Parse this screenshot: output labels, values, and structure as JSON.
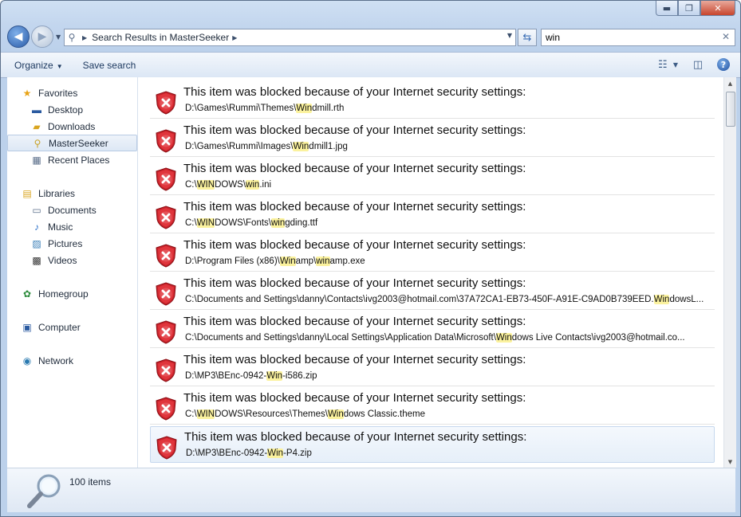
{
  "window": {
    "buttons": {
      "minimize": "▬",
      "maximize": "❐",
      "close": "✕"
    }
  },
  "address": {
    "crumb": "Search Results in MasterSeeker"
  },
  "search": {
    "value": "win"
  },
  "toolbar": {
    "organize": "Organize",
    "save_search": "Save search"
  },
  "sidebar": {
    "favorites": "Favorites",
    "desktop": "Desktop",
    "downloads": "Downloads",
    "masterseeker": "MasterSeeker",
    "recent_places": "Recent Places",
    "libraries": "Libraries",
    "documents": "Documents",
    "music": "Music",
    "pictures": "Pictures",
    "videos": "Videos",
    "homegroup": "Homegroup",
    "computer": "Computer",
    "network": "Network"
  },
  "results": {
    "message": "This item was blocked because of your Internet security settings:",
    "items": [
      {
        "path": [
          [
            "D:\\Games\\Rummi\\Themes\\",
            0
          ],
          [
            "Win",
            1
          ],
          [
            "dmill.rth",
            0
          ]
        ]
      },
      {
        "path": [
          [
            "D:\\Games\\Rummi\\Images\\",
            0
          ],
          [
            "Win",
            1
          ],
          [
            "dmill1.jpg",
            0
          ]
        ]
      },
      {
        "path": [
          [
            "C:\\",
            0
          ],
          [
            "WIN",
            1
          ],
          [
            "DOWS\\",
            0
          ],
          [
            "win",
            1
          ],
          [
            ".ini",
            0
          ]
        ]
      },
      {
        "path": [
          [
            "C:\\",
            0
          ],
          [
            "WIN",
            1
          ],
          [
            "DOWS\\Fonts\\",
            0
          ],
          [
            "win",
            1
          ],
          [
            "gding.ttf",
            0
          ]
        ]
      },
      {
        "path": [
          [
            "D:\\Program Files (x86)\\",
            0
          ],
          [
            "Win",
            1
          ],
          [
            "amp\\",
            0
          ],
          [
            "win",
            1
          ],
          [
            "amp.exe",
            0
          ]
        ]
      },
      {
        "path": [
          [
            "C:\\Documents and Settings\\danny\\Contacts\\ivg2003@hotmail.com\\37A72CA1-EB73-450F-A91E-C9AD0B739EED.",
            0
          ],
          [
            "Win",
            1
          ],
          [
            "dowsL...",
            0
          ]
        ]
      },
      {
        "path": [
          [
            "C:\\Documents and Settings\\danny\\Local Settings\\Application Data\\Microsoft\\",
            0
          ],
          [
            "Win",
            1
          ],
          [
            "dows Live Contacts\\ivg2003@hotmail.co...",
            0
          ]
        ]
      },
      {
        "path": [
          [
            "D:\\MP3\\BEnc-0942-",
            0
          ],
          [
            "Win",
            1
          ],
          [
            "-i586.zip",
            0
          ]
        ]
      },
      {
        "path": [
          [
            "C:\\",
            0
          ],
          [
            "WIN",
            1
          ],
          [
            "DOWS\\Resources\\Themes\\",
            0
          ],
          [
            "Win",
            1
          ],
          [
            "dows Classic.theme",
            0
          ]
        ]
      },
      {
        "path": [
          [
            "D:\\MP3\\BEnc-0942-",
            0
          ],
          [
            "Win",
            1
          ],
          [
            "-P4.zip",
            0
          ]
        ]
      }
    ]
  },
  "details": {
    "count": "100 items"
  }
}
